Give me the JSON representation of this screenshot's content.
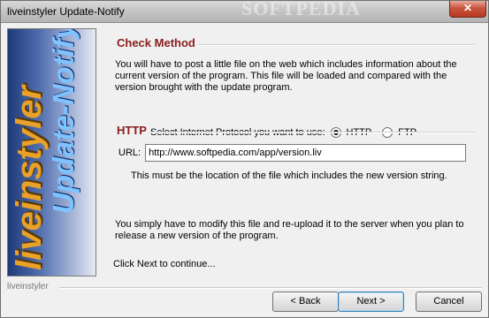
{
  "window": {
    "title": "liveinstyler Update-Notify",
    "close_label": "✕",
    "watermark": "SOFTPEDIA"
  },
  "sidebar": {
    "brand_line1": "liveinstyler",
    "brand_line2": "Update-Notify"
  },
  "check_method": {
    "heading": "Check Method",
    "description": "You will have to post a little file on the web which includes information about the current version of the program. This file will be loaded and compared with the version brought with the update program.",
    "protocol_label": "Select Internet Protocol you want to use:",
    "options": [
      {
        "label": "HTTP",
        "selected": true
      },
      {
        "label": "FTP",
        "selected": false
      }
    ]
  },
  "http": {
    "heading": "HTTP",
    "url_label": "URL:",
    "url_value": "http://www.softpedia.com/app/version.liv",
    "hint": "This must be the location of the file which includes the new version string."
  },
  "info_text": "You simply have to modify this file and re-upload it to the server when you plan to release a new version of the program.",
  "continue_text": "Click Next to continue...",
  "footer": {
    "label": "liveinstyler",
    "back_label": "< Back",
    "next_label": "Next >",
    "cancel_label": "Cancel"
  }
}
